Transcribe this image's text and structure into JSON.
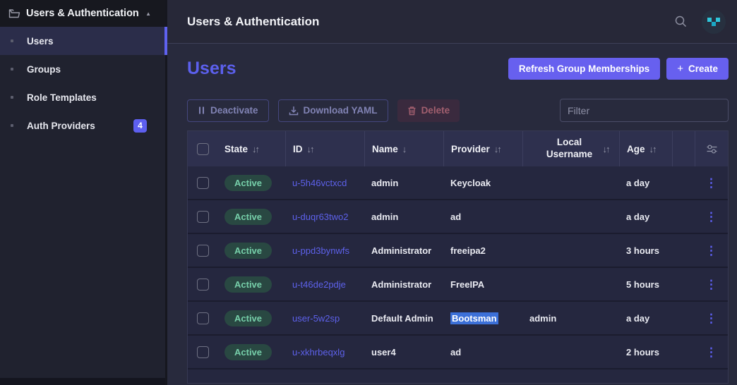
{
  "colors": {
    "accent": "#5f62f0",
    "button_primary": "#6760ef",
    "link": "#5d61ea",
    "badge_active_bg": "#294842",
    "badge_active_text": "#76cfa9",
    "danger_text": "#a25f6f",
    "selection_highlight": "#3c70d8",
    "identicon_teal": "#2ec5da"
  },
  "icons": {
    "sidebar_header": "folder-icon",
    "sidebar_collapse": "chevron-up-icon",
    "search": "search-icon",
    "avatar": "identicon-avatar",
    "deactivate": "pause-icon",
    "download": "download-icon",
    "delete": "trash-icon",
    "create": "plus-icon",
    "row_menu": "kebab-menu-icon",
    "column_settings": "sliders-icon"
  },
  "sidebar": {
    "header": {
      "label": "Users & Authentication",
      "collapse_glyph": "▲"
    },
    "items": [
      {
        "label": "Users",
        "selected": true
      },
      {
        "label": "Groups"
      },
      {
        "label": "Role Templates"
      },
      {
        "label": "Auth Providers",
        "badge": "4"
      }
    ]
  },
  "topbar": {
    "title": "Users & Authentication"
  },
  "page": {
    "title": "Users",
    "refresh_button": "Refresh Group Memberships",
    "create_button": "Create",
    "create_plus": "+",
    "deactivate_button": "Deactivate",
    "download_button": "Download YAML",
    "delete_button": "Delete",
    "filter_placeholder": "Filter"
  },
  "table": {
    "columns": [
      {
        "label": "State",
        "sort_glyph": "↓↑"
      },
      {
        "label": "ID",
        "sort_glyph": "↓↑"
      },
      {
        "label": "Name",
        "sort_glyph": "↓"
      },
      {
        "label": "Provider",
        "sort_glyph": "↓↑"
      },
      {
        "label": "Local Username",
        "sort_glyph": "↓↑"
      },
      {
        "label": "Age",
        "sort_glyph": "↓↑"
      }
    ],
    "rows": [
      {
        "state": "Active",
        "id": "u-5h46vctxcd",
        "name": "admin",
        "provider": "Keycloak",
        "local_username": "",
        "age": "a day"
      },
      {
        "state": "Active",
        "id": "u-duqr63two2",
        "name": "admin",
        "provider": "ad",
        "local_username": "",
        "age": "a day"
      },
      {
        "state": "Active",
        "id": "u-ppd3bynwfs",
        "name": "Administrator",
        "provider": "freeipa2",
        "local_username": "",
        "age": "3 hours"
      },
      {
        "state": "Active",
        "id": "u-t46de2pdje",
        "name": "Administrator",
        "provider": "FreeIPA",
        "local_username": "",
        "age": "5 hours"
      },
      {
        "state": "Active",
        "id": "user-5w2sp",
        "name": "Default Admin",
        "provider": "Bootsman",
        "provider_highlighted": true,
        "local_username": "admin",
        "age": "a day"
      },
      {
        "state": "Active",
        "id": "u-xkhrbeqxlg",
        "name": "user4",
        "provider": "ad",
        "local_username": "",
        "age": "2 hours"
      }
    ]
  }
}
